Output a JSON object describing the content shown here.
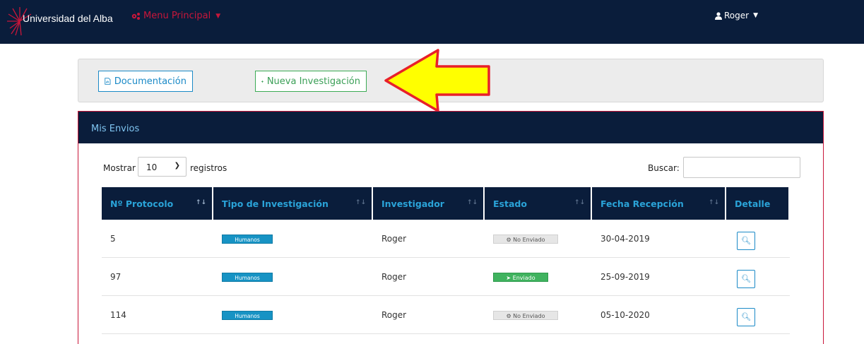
{
  "navbar": {
    "brand": "Universidad del Alba",
    "menu_label": "Menu Principal",
    "user_label": "Roger"
  },
  "toolbar": {
    "doc_label": "Documentación",
    "new_label": "Nueva Investigación"
  },
  "panel": {
    "title": "Mis Envios"
  },
  "controls": {
    "show_label": "Mostrar",
    "show_value": "10",
    "show_after": "registros",
    "search_label": "Buscar:"
  },
  "table": {
    "headers": [
      "Nº Protocolo",
      "Tipo de Investigación",
      "Investigador",
      "Estado",
      "Fecha Recepción",
      "Detalle"
    ],
    "rows": [
      {
        "protocol": "5",
        "type": "Humanos",
        "researcher": "Roger",
        "state": "No Enviado",
        "date": "30-04-2019"
      },
      {
        "protocol": "97",
        "type": "Humanos",
        "researcher": "Roger",
        "state": "Enviado",
        "date": "25-09-2019"
      },
      {
        "protocol": "114",
        "type": "Humanos",
        "researcher": "Roger",
        "state": "No Enviado",
        "date": "05-10-2020"
      }
    ]
  },
  "colors": {
    "navy": "#0a1d3b",
    "accent_red": "#c8163a",
    "blue": "#1b8ac7",
    "green": "#3cab55",
    "arrow_fill": "#ffff00",
    "arrow_stroke": "#e8202a"
  },
  "icons": {
    "doc": "file-pdf-icon",
    "new": "plus-icon",
    "menu": "gears-icon",
    "user": "user-icon",
    "detail": "search-icon",
    "not_sent": "gears-icon",
    "sent": "paper-plane-icon"
  }
}
